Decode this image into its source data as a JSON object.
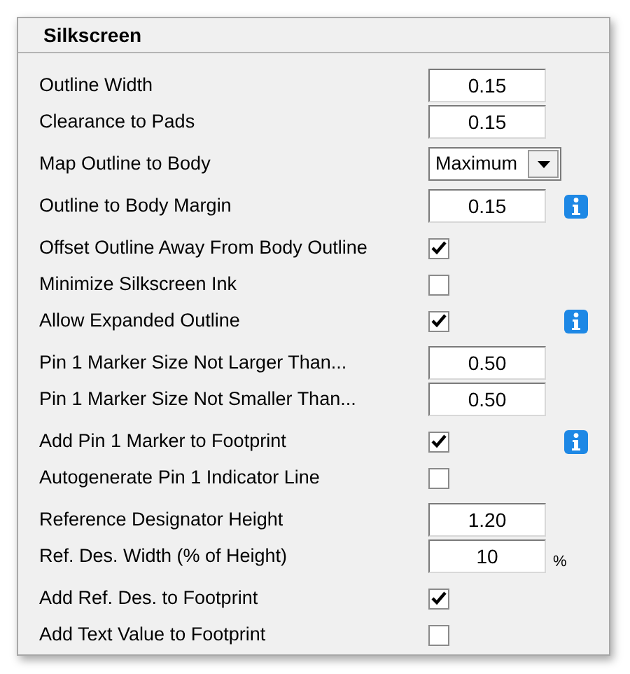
{
  "panel": {
    "title": "Silkscreen"
  },
  "groups": [
    {
      "rows": [
        {
          "kind": "number",
          "label": "Outline Width",
          "value": "0.15"
        },
        {
          "kind": "number",
          "label": "Clearance to Pads",
          "value": "0.15"
        }
      ]
    },
    {
      "rows": [
        {
          "kind": "select",
          "label": "Map Outline to Body",
          "value": "Maximum"
        }
      ]
    },
    {
      "rows": [
        {
          "kind": "number",
          "label": "Outline to Body Margin",
          "value": "0.15",
          "info": true
        }
      ]
    },
    {
      "rows": [
        {
          "kind": "check",
          "label": "Offset Outline Away From Body Outline",
          "checked": true
        },
        {
          "kind": "check",
          "label": "Minimize Silkscreen Ink",
          "checked": false
        },
        {
          "kind": "check",
          "label": "Allow Expanded Outline",
          "checked": true,
          "info": true
        }
      ]
    },
    {
      "rows": [
        {
          "kind": "number",
          "label": "Pin 1 Marker Size Not Larger Than...",
          "value": "0.50"
        },
        {
          "kind": "number",
          "label": "Pin 1 Marker Size Not Smaller Than...",
          "value": "0.50"
        }
      ]
    },
    {
      "rows": [
        {
          "kind": "check",
          "label": "Add Pin 1 Marker to Footprint",
          "checked": true,
          "info": true
        },
        {
          "kind": "check",
          "label": "Autogenerate Pin 1 Indicator Line",
          "checked": false
        }
      ]
    },
    {
      "rows": [
        {
          "kind": "number",
          "label": "Reference Designator Height",
          "value": "1.20"
        },
        {
          "kind": "number",
          "label": "Ref. Des. Width (% of Height)",
          "value": "10",
          "unit": "%"
        }
      ]
    },
    {
      "rows": [
        {
          "kind": "check",
          "label": "Add Ref. Des. to Footprint",
          "checked": true
        },
        {
          "kind": "check",
          "label": "Add Text Value to Footprint",
          "checked": false
        }
      ]
    }
  ]
}
